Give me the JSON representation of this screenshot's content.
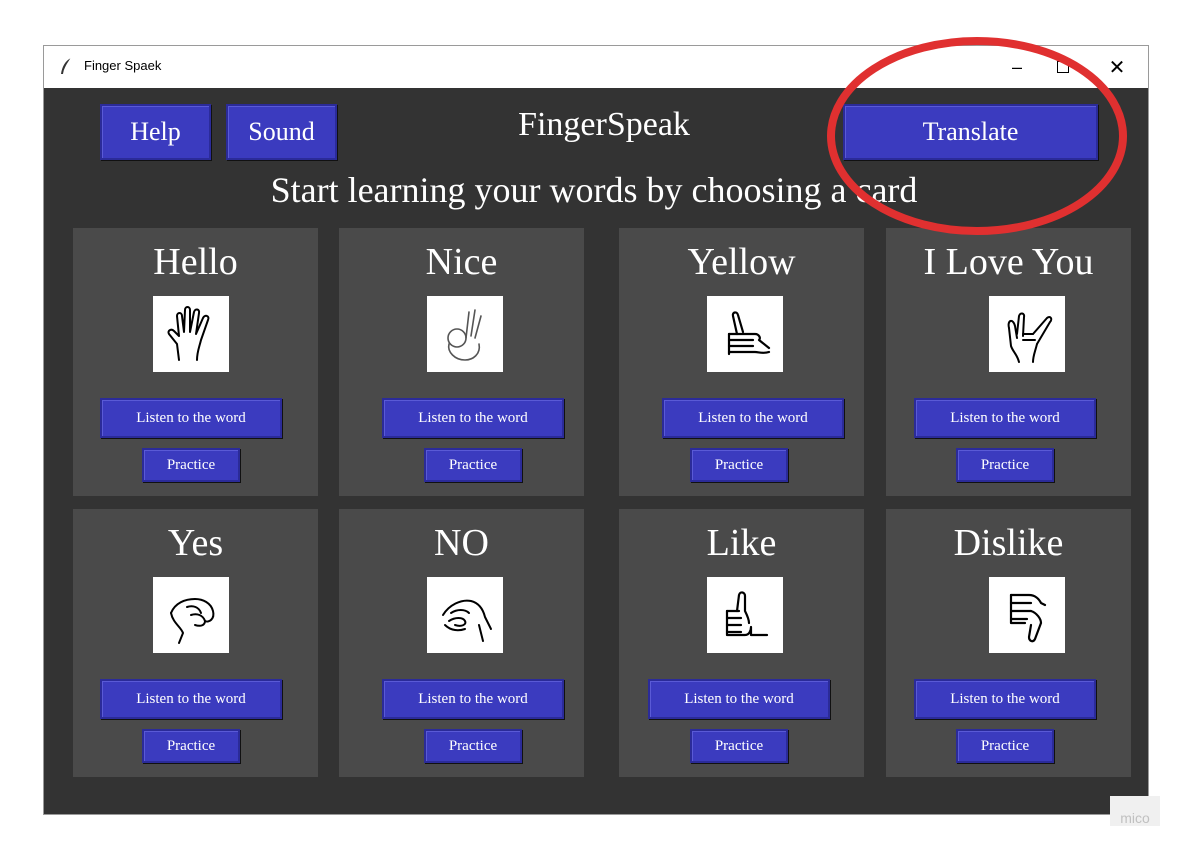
{
  "window": {
    "title": "Finger Spaek",
    "minimize_glyph": "–",
    "close_glyph": "✕"
  },
  "header": {
    "help_label": "Help",
    "sound_label": "Sound",
    "app_title": "FingerSpeak",
    "translate_label": "Translate",
    "subtitle": "Start learning your words by choosing a card"
  },
  "cards": [
    {
      "word": "Hello",
      "icon": "open-hand-icon",
      "listen_label": "Listen to the word",
      "practice_label": "Practice"
    },
    {
      "word": "Nice",
      "icon": "ok-hand-icon",
      "listen_label": "Listen to the word",
      "practice_label": "Practice"
    },
    {
      "word": "Yellow",
      "icon": "shaka-hand-icon",
      "listen_label": "Listen to the word",
      "practice_label": "Practice"
    },
    {
      "word": "I Love You",
      "icon": "ily-hand-icon",
      "listen_label": "Listen to the word",
      "practice_label": "Practice"
    },
    {
      "word": "Yes",
      "icon": "fist-hand-icon",
      "listen_label": "Listen to the word",
      "practice_label": "Practice"
    },
    {
      "word": "NO",
      "icon": "no-hand-icon",
      "listen_label": "Listen to the word",
      "practice_label": "Practice"
    },
    {
      "word": "Like",
      "icon": "thumbs-up-icon",
      "listen_label": "Listen to the word",
      "practice_label": "Practice"
    },
    {
      "word": "Dislike",
      "icon": "thumbs-down-icon",
      "listen_label": "Listen to the word",
      "practice_label": "Practice"
    }
  ],
  "watermark": "mico",
  "colors": {
    "background": "#333333",
    "card": "#4a4a4a",
    "button": "#3b3bbf",
    "annotation": "#e03030"
  }
}
